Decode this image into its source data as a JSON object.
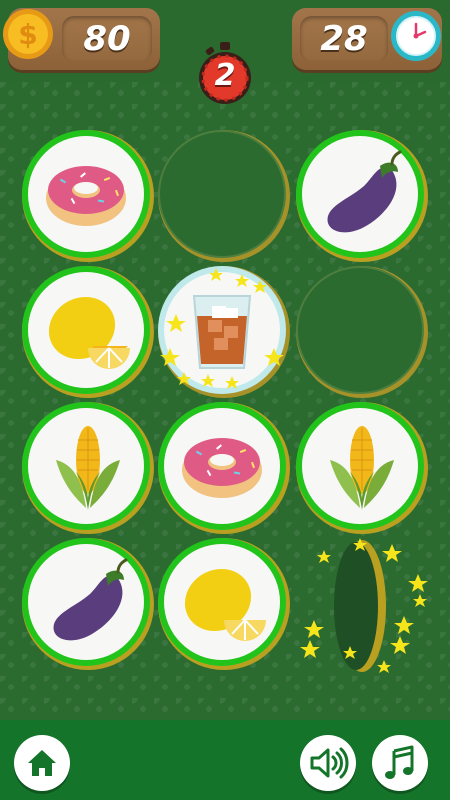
{
  "hud": {
    "coins": "80",
    "time_remaining": "28",
    "countdown": "2",
    "coin_icon": "dollar-coin-icon",
    "clock_icon": "clock-icon",
    "stopwatch_icon": "stopwatch-icon"
  },
  "board": {
    "rows": 4,
    "cols": 3,
    "cards": [
      {
        "item": "donut",
        "state": "face-up"
      },
      {
        "item": "",
        "state": "face-down"
      },
      {
        "item": "eggplant",
        "state": "face-up"
      },
      {
        "item": "lemon",
        "state": "face-up"
      },
      {
        "item": "iced-drink",
        "state": "selected"
      },
      {
        "item": "",
        "state": "face-down"
      },
      {
        "item": "corn",
        "state": "face-up"
      },
      {
        "item": "donut",
        "state": "face-up"
      },
      {
        "item": "corn",
        "state": "face-up"
      },
      {
        "item": "eggplant",
        "state": "face-up"
      },
      {
        "item": "lemon",
        "state": "face-up"
      },
      {
        "item": "",
        "state": "flipping"
      }
    ]
  },
  "footer": {
    "home_icon": "home-icon",
    "sound_icon": "speaker-icon",
    "music_icon": "music-note-icon"
  },
  "colors": {
    "board_green": "#2c6b30",
    "card_ring": "#22c41c",
    "gold": "#b9a021",
    "selected_ring": "#bfe9ea",
    "footer_green": "#14752a",
    "panel_wood": "#9a6d42"
  }
}
